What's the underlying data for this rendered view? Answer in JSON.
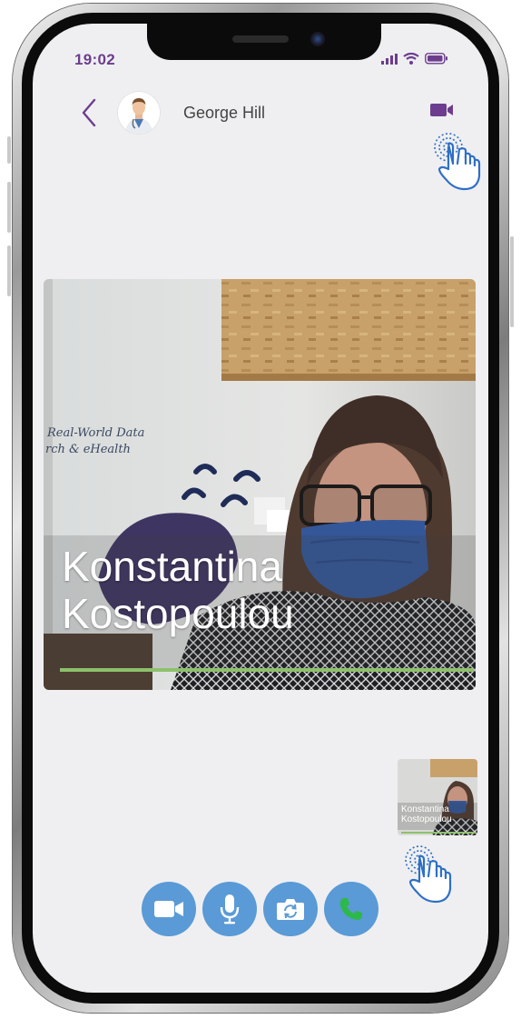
{
  "status_bar": {
    "time": "19:02",
    "icons": [
      "signal-icon",
      "wifi-icon",
      "battery-icon"
    ]
  },
  "header": {
    "back_icon": "chevron-left-icon",
    "contact_name": "George Hill",
    "video_icon": "video-camera-icon"
  },
  "main_video": {
    "participant_name": "Konstantina Kostopoulou",
    "name_line_1": "Konstantina",
    "name_line_2": "Kostopoulou",
    "progress": 1.0,
    "wall_text_1": "Real-World Data",
    "wall_text_2": "rch & eHealth"
  },
  "self_view": {
    "name_line_1": "Konstantina",
    "name_line_2": "Kostopoulou"
  },
  "call_controls": [
    {
      "id": "camera",
      "icon": "video-camera-icon"
    },
    {
      "id": "mic",
      "icon": "microphone-icon"
    },
    {
      "id": "switch",
      "icon": "switch-camera-icon"
    },
    {
      "id": "phone",
      "icon": "phone-icon"
    }
  ],
  "colors": {
    "accent_purple": "#6c3d8e",
    "control_blue": "#5a9ad6",
    "call_green": "#2db84a",
    "hint_hand_blue": "#2f6fc6"
  }
}
